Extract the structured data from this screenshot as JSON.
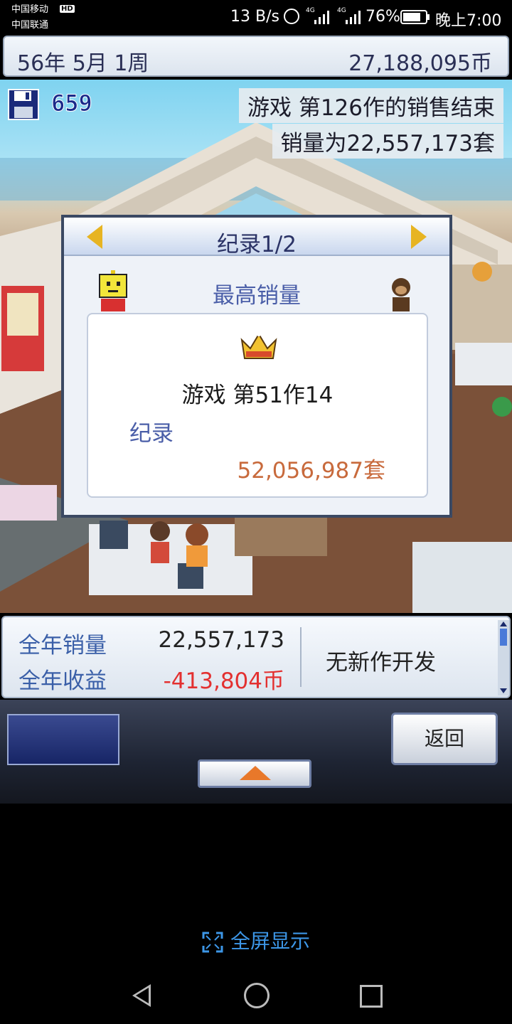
{
  "status_bar": {
    "carrier1": "中国移动",
    "hd": "HD",
    "carrier2": "中国联通",
    "speed": "13 B/s",
    "net1": "4G",
    "net2": "4G",
    "battery": "76%",
    "time": "晚上7:00"
  },
  "top_bar": {
    "date": "56年 5月 1周",
    "money": "27,188,095币"
  },
  "scene": {
    "save_count": "659",
    "news_line1": "游戏 第126作的销售结束",
    "news_line2": "销量为22,557,173套"
  },
  "dialog": {
    "title": "纪录1/2",
    "subtitle": "最高销量",
    "game_name": "游戏 第51作14",
    "record_label": "纪录",
    "record_value": "52,056,987套"
  },
  "stats": {
    "sales_label": "全年销量",
    "sales_value": "22,557,173",
    "revenue_label": "全年收益",
    "revenue_value": "-413,804币",
    "dev_status": "无新作开发"
  },
  "controls": {
    "back_label": "返回"
  },
  "fullscreen_label": "全屏显示",
  "colors": {
    "accent": "#3a5fa8",
    "negative": "#e33030",
    "record_value": "#c86a3c",
    "fullscreen": "#3d97e8"
  }
}
